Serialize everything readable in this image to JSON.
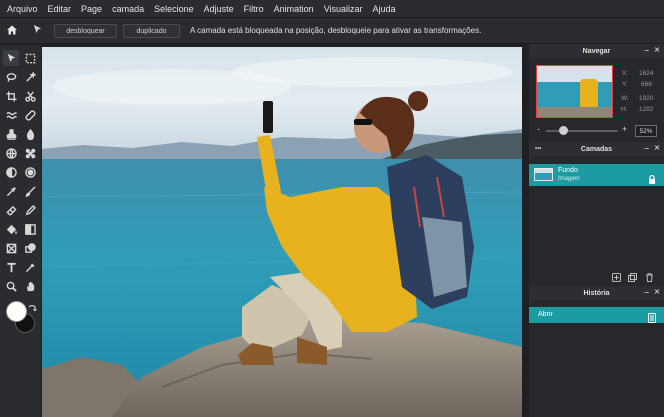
{
  "menu": [
    "Arquivo",
    "Editar",
    "Page",
    "camada",
    "Selecione",
    "Adjuste",
    "Filtro",
    "Animation",
    "Visualizar",
    "Ajuda"
  ],
  "options": {
    "unlock_label": "desbloquear",
    "duplicate_label": "duplicado",
    "message": "A camada está bloqueada na posição, desbloqueie para ativar as transformações."
  },
  "navigator": {
    "title": "Navegar",
    "x_label": "X:",
    "x_value": "1624",
    "y_label": "Y:",
    "y_value": "668",
    "w_label": "W:",
    "w_value": "1920",
    "h_label": "H:",
    "h_value": "1282",
    "zoom": "52%",
    "zoom_minus": "-",
    "zoom_plus": "+"
  },
  "layers": {
    "title": "Camadas",
    "layer_name": "Fundo",
    "layer_type": "Imagem",
    "dots": "•••"
  },
  "history": {
    "title": "História",
    "item": "Abrir"
  },
  "panel_controls": {
    "minimize": "–",
    "close": "✕"
  },
  "colors": {
    "accent": "#1d9ba2",
    "foreground": "#ffffff",
    "background": "#111111"
  }
}
